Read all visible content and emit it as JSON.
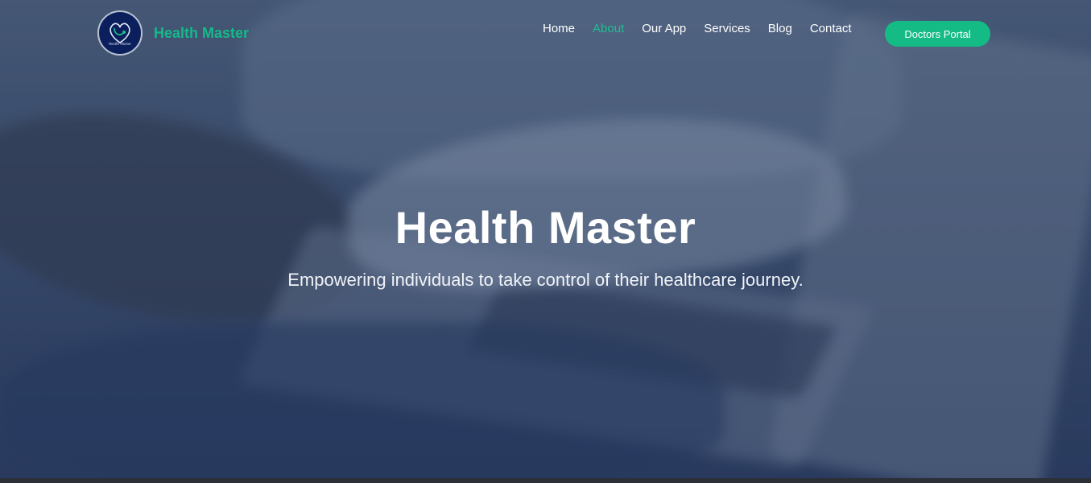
{
  "brand": {
    "name": "Health Master",
    "logo_icon": "heart-stethoscope-logo",
    "logo_caption": "Health Master"
  },
  "nav": {
    "items": [
      {
        "label": "Home",
        "active": false
      },
      {
        "label": "About",
        "active": true
      },
      {
        "label": "Our App",
        "active": false
      },
      {
        "label": "Services",
        "active": false
      },
      {
        "label": "Blog",
        "active": false
      },
      {
        "label": "Contact",
        "active": false
      }
    ],
    "cta_label": "Doctors Portal"
  },
  "hero": {
    "title": "Health Master",
    "subtitle": "Empowering individuals to take control of their healthcare journey."
  },
  "colors": {
    "accent": "#14bb85",
    "active_link": "#1ec08f",
    "logo_bg": "#0b1f5c"
  }
}
